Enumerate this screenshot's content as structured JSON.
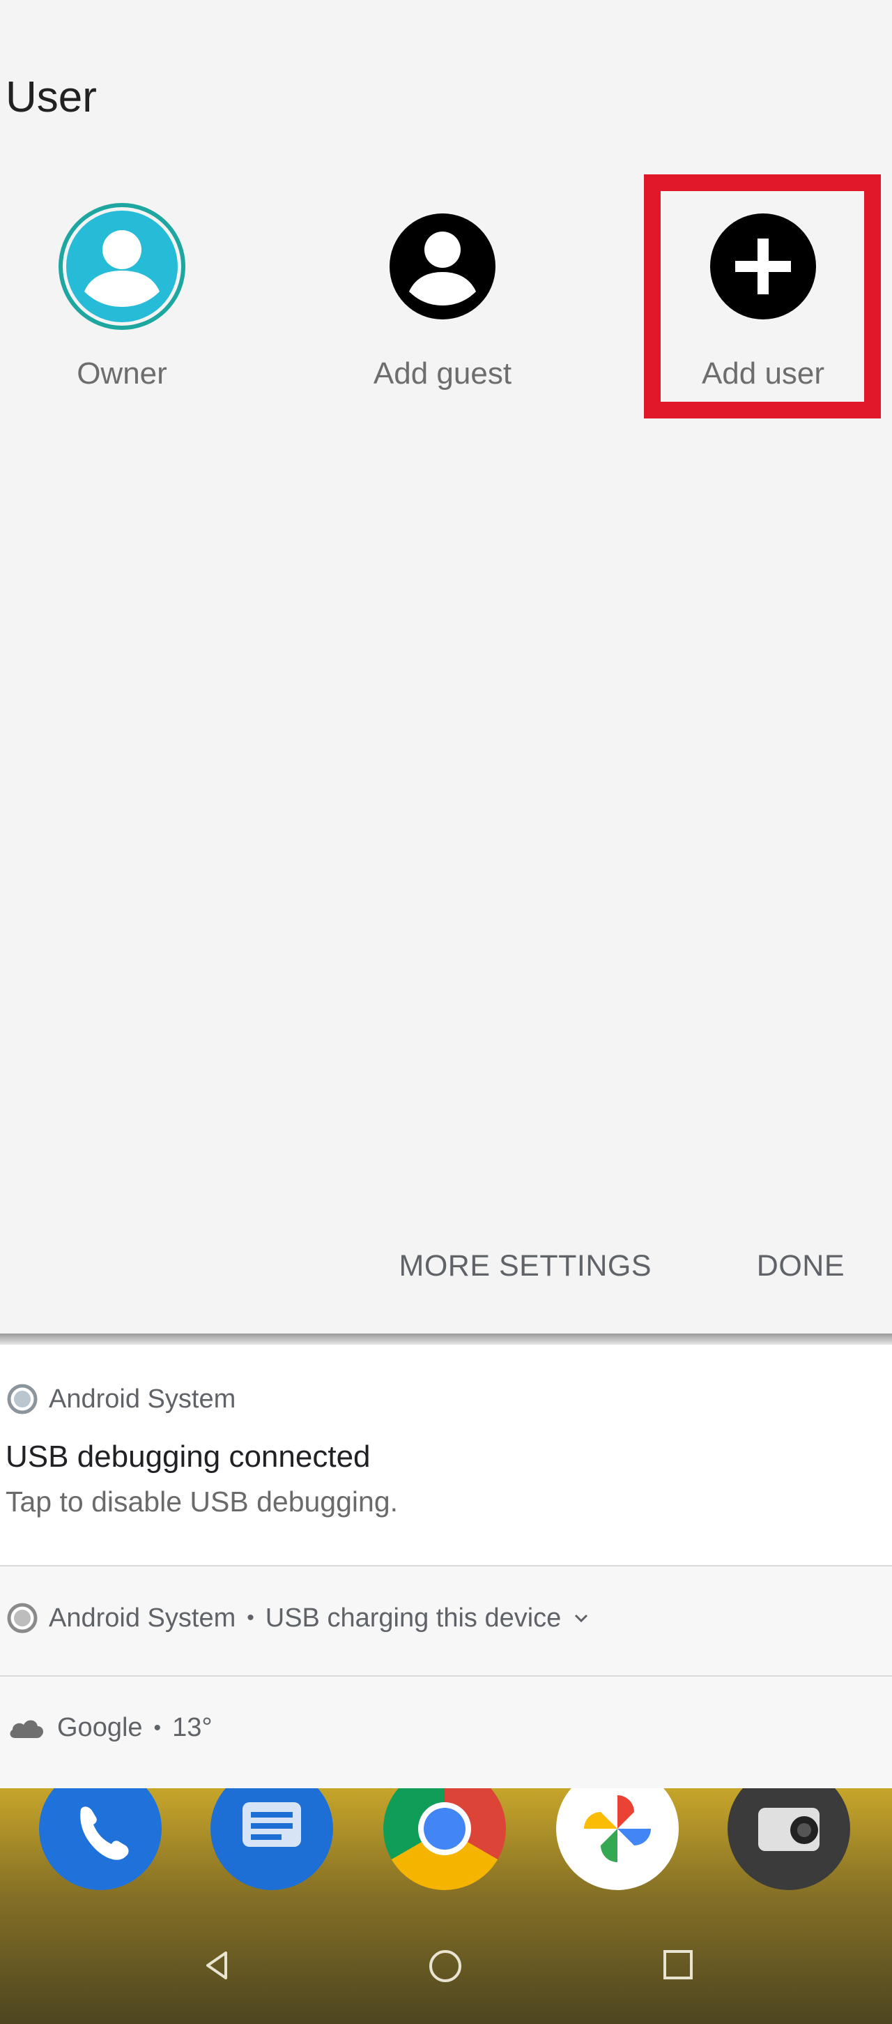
{
  "user_panel": {
    "title": "User",
    "tiles": [
      {
        "label": "Owner",
        "icon": "account-circle-icon",
        "color": "#26bcd7"
      },
      {
        "label": "Add guest",
        "icon": "account-circle-icon",
        "color": "#000000"
      },
      {
        "label": "Add user",
        "icon": "add-circle-icon",
        "color": "#000000"
      }
    ],
    "highlight_color": "#e0182a",
    "actions": {
      "more_settings": "MORE SETTINGS",
      "done": "DONE"
    }
  },
  "notifications": [
    {
      "app": "Android System",
      "title": "USB debugging connected",
      "body": "Tap to disable USB debugging."
    },
    {
      "app": "Android System",
      "separator": "•",
      "summary": "USB charging this device",
      "chevron": "chevron-down-icon"
    },
    {
      "app": "Google",
      "separator": "•",
      "summary": "13°",
      "icon": "cloud-icon"
    }
  ],
  "home_screen": {
    "dock_apps": [
      "phone-icon",
      "messages-icon",
      "chrome-icon",
      "photos-icon",
      "camera-icon"
    ],
    "nav": [
      "back-icon",
      "home-icon",
      "recents-icon"
    ]
  }
}
